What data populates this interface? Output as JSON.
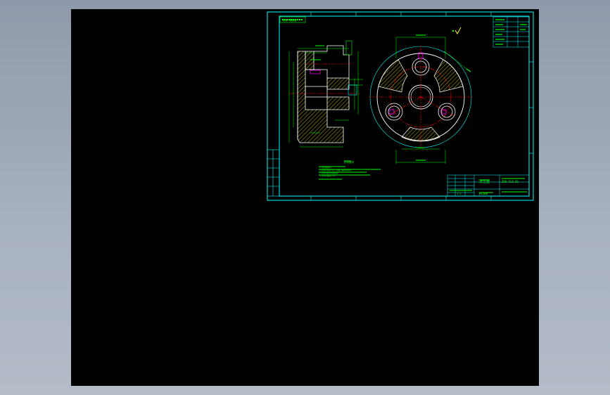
{
  "colors": {
    "background_gradient_top": "#8e9aab",
    "background_gradient_bottom": "#b4bcc8",
    "viewport": "#000000",
    "frame": "#00ffff",
    "outline": "#ffffff",
    "dimension": "#00ff00",
    "centerline": "#ff0000",
    "hatch": "#ffff00",
    "accent": "#ff00ff",
    "text": "#00ff00"
  },
  "drawing": {
    "title_block": {
      "part_name": "法兰盘",
      "drawing_number": "ZHS-FLD-01",
      "material": "HT200",
      "scale": "1:1"
    },
    "tech_requirements_title": "技术要求",
    "tech_requirements": [
      "1.未注倒角C1.",
      "2.铸件不得有气孔、砂眼、缩松等缺陷.",
      "3.铸件应进行时效处理.",
      "4.未注公差按IT14."
    ],
    "note_top_left": "其余 粗糙度"
  }
}
